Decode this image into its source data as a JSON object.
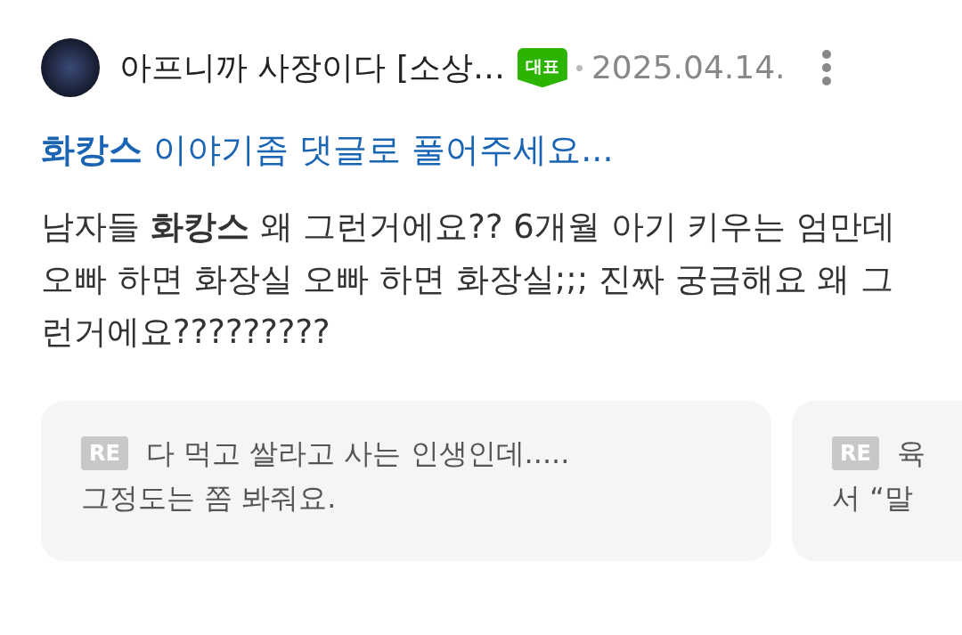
{
  "post": {
    "author": "아프니까 사장이다 [소상…",
    "badge": "대표",
    "date": "2025.04.14.",
    "title": "**화캉스** 이야기좀 댓글로 풀어주세요...",
    "body": "남자들 **화캉스** 왜 그런거에요?? 6개월 아기 키우는 엄만데 오빠 하면 화장실 오빠 하면 화장실;;; 진짜 궁금해요 왜 그런거에요?????????"
  },
  "comments": [
    {
      "tag": "RE",
      "lines": [
        "다 먹고 쌀라고 사는 인생인데.....",
        "그정도는 쫌 봐줘요."
      ]
    },
    {
      "tag": "RE",
      "lines": [
        "육",
        "서 “말"
      ]
    }
  ]
}
